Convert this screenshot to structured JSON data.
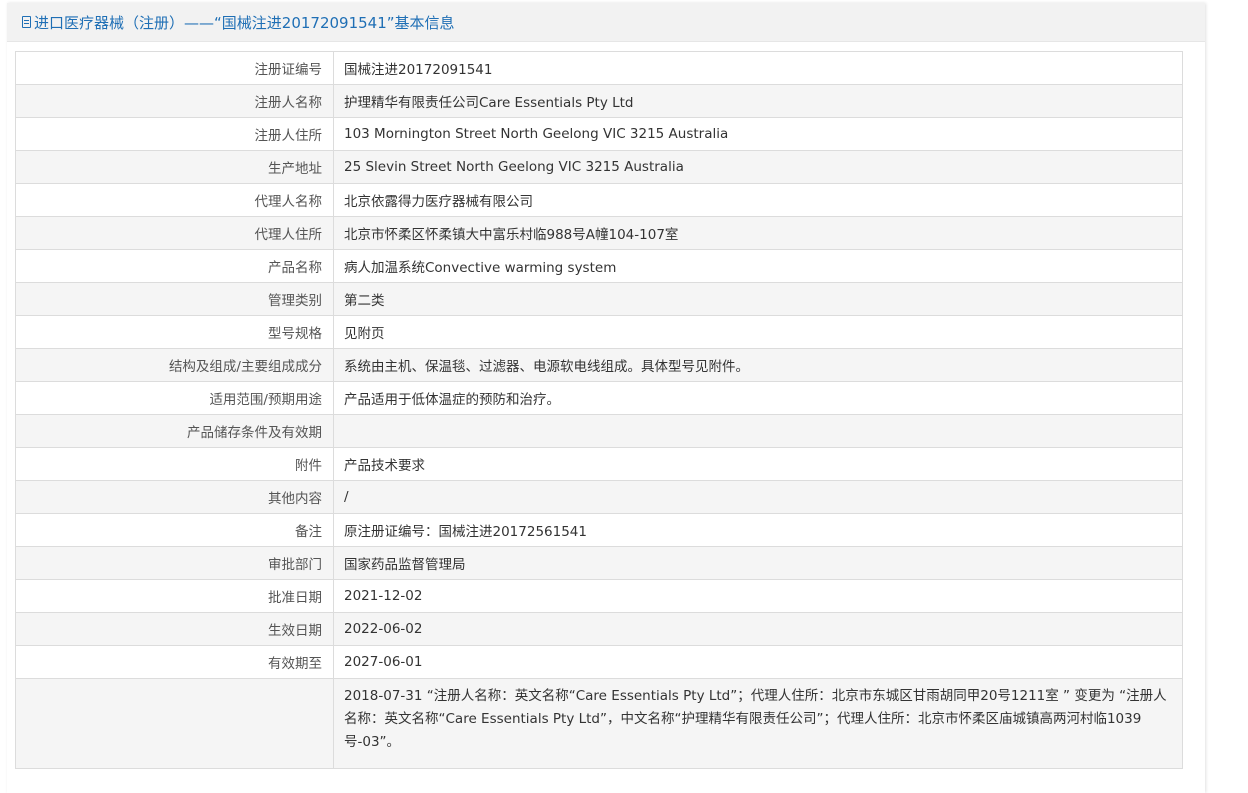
{
  "header": {
    "title": "进口医疗器械（注册）——“国械注进20172091541”基本信息",
    "icon": "document-icon",
    "color": "#1f6fb5"
  },
  "rows": [
    {
      "label": "注册证编号",
      "value": "国械注进20172091541"
    },
    {
      "label": "注册人名称",
      "value": "护理精华有限责任公司Care Essentials Pty Ltd"
    },
    {
      "label": "注册人住所",
      "value": "103 Mornington Street North Geelong VIC 3215 Australia"
    },
    {
      "label": "生产地址",
      "value": "25 Slevin Street North Geelong VIC 3215 Australia"
    },
    {
      "label": "代理人名称",
      "value": "北京依露得力医疗器械有限公司"
    },
    {
      "label": "代理人住所",
      "value": "北京市怀柔区怀柔镇大中富乐村临988号A幢104-107室"
    },
    {
      "label": "产品名称",
      "value": "病人加温系统Convective warming system"
    },
    {
      "label": "管理类别",
      "value": "第二类"
    },
    {
      "label": "型号规格",
      "value": "见附页"
    },
    {
      "label": "结构及组成/主要组成成分",
      "value": "系统由主机、保温毯、过滤器、电源软电线组成。具体型号见附件。"
    },
    {
      "label": "适用范围/预期用途",
      "value": "产品适用于低体温症的预防和治疗。"
    },
    {
      "label": "产品储存条件及有效期",
      "value": ""
    },
    {
      "label": "附件",
      "value": "产品技术要求"
    },
    {
      "label": "其他内容",
      "value": "/"
    },
    {
      "label": "备注",
      "value": "原注册证编号：国械注进20172561541"
    },
    {
      "label": "审批部门",
      "value": "国家药品监督管理局"
    },
    {
      "label": "批准日期",
      "value": "2021-12-02"
    },
    {
      "label": "生效日期",
      "value": "2022-06-02"
    },
    {
      "label": "有效期至",
      "value": "2027-06-01"
    },
    {
      "label": "",
      "value": "2018-07-31 “注册人名称：英文名称“Care Essentials Pty Ltd”；代理人住所：北京市东城区甘雨胡同甲20号1211室 ” 变更为 “注册人名称：英文名称“Care Essentials Pty Ltd”，中文名称“护理精华有限责任公司”；代理人住所：北京市怀柔区庙城镇高两河村临1039号-03”。"
    }
  ]
}
